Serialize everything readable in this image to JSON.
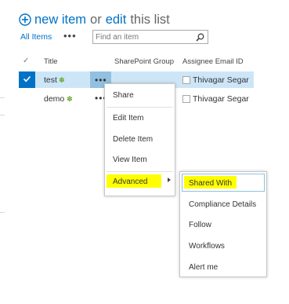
{
  "header": {
    "new_item": "new item",
    "or": "or",
    "edit": "edit",
    "this_list": "this list"
  },
  "view": {
    "all_items": "All Items",
    "ellipsis": "•••",
    "search_placeholder": "Find an item"
  },
  "columns": {
    "check": "✓",
    "title": "Title",
    "sharepoint_group": "SharePoint Group",
    "assignee_email": "Assignee Email ID"
  },
  "rows": [
    {
      "title": "test",
      "new_marker": "✽",
      "ellipsis": "•••",
      "assignee": "Thivagar Segar",
      "selected": true
    },
    {
      "title": "demo",
      "new_marker": "✽",
      "ellipsis": "•••",
      "assignee": "Thivagar Segar",
      "selected": false
    }
  ],
  "item_menu": {
    "items": [
      "Share",
      "Edit Item",
      "Delete Item",
      "View Item",
      "Advanced"
    ]
  },
  "advanced_menu": {
    "items": [
      "Shared With",
      "Compliance Details",
      "Follow",
      "Workflows",
      "Alert me"
    ]
  },
  "colors": {
    "accent": "#0072c6",
    "selected_row": "#cde6f7",
    "highlight": "#ffff00",
    "new_marker": "#6ca52b"
  }
}
